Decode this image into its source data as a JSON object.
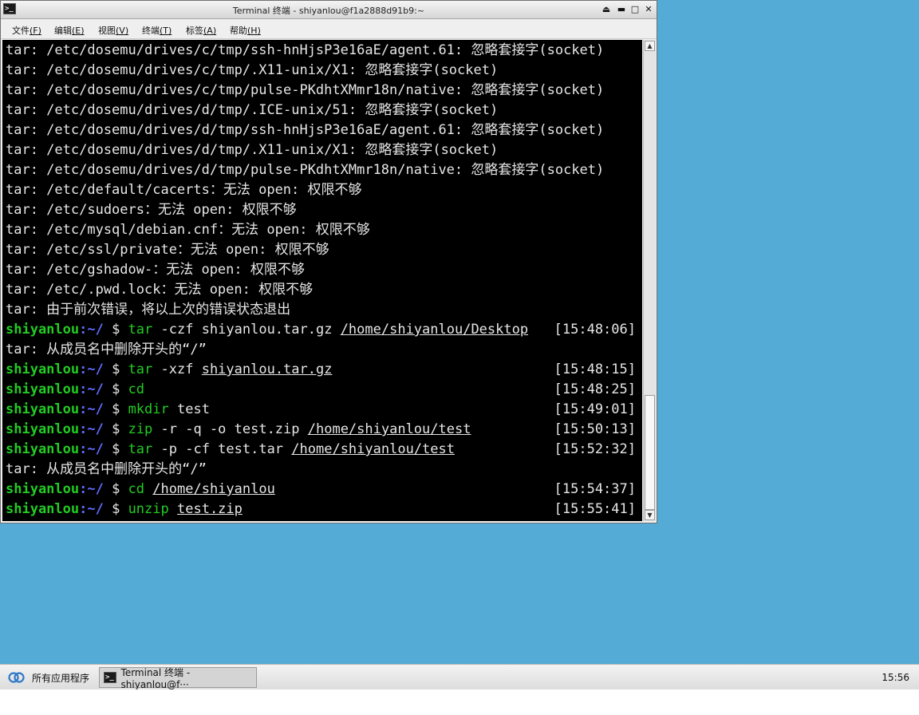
{
  "window": {
    "title": "Terminal 终端 - shiyanlou@f1a2888d91b9:~",
    "menu": [
      {
        "label": "文件",
        "key": "(F)"
      },
      {
        "label": "编辑",
        "key": "(E)"
      },
      {
        "label": "视图",
        "key": "(V)"
      },
      {
        "label": "终端",
        "key": "(T)"
      },
      {
        "label": "标签",
        "key": "(A)"
      },
      {
        "label": "帮助",
        "key": "(H)"
      }
    ]
  },
  "terminal": {
    "prompt_user": "shiyanlou",
    "prompt_path": ":~/",
    "prompt_sym": " $ ",
    "lines": [
      {
        "kind": "out",
        "text": "tar: /etc/dosemu/drives/c/tmp/ssh-hnHjsP3e16aE/agent.61: 忽略套接字(socket)"
      },
      {
        "kind": "out",
        "text": "tar: /etc/dosemu/drives/c/tmp/.X11-unix/X1: 忽略套接字(socket)"
      },
      {
        "kind": "out",
        "text": "tar: /etc/dosemu/drives/c/tmp/pulse-PKdhtXMmr18n/native: 忽略套接字(socket)"
      },
      {
        "kind": "out",
        "text": "tar: /etc/dosemu/drives/d/tmp/.ICE-unix/51: 忽略套接字(socket)"
      },
      {
        "kind": "out",
        "text": "tar: /etc/dosemu/drives/d/tmp/ssh-hnHjsP3e16aE/agent.61: 忽略套接字(socket)"
      },
      {
        "kind": "out",
        "text": "tar: /etc/dosemu/drives/d/tmp/.X11-unix/X1: 忽略套接字(socket)"
      },
      {
        "kind": "out",
        "text": "tar: /etc/dosemu/drives/d/tmp/pulse-PKdhtXMmr18n/native: 忽略套接字(socket)"
      },
      {
        "kind": "out",
        "text": "tar: /etc/default/cacerts：无法 open: 权限不够"
      },
      {
        "kind": "out",
        "text": "tar: /etc/sudoers：无法 open: 权限不够"
      },
      {
        "kind": "out",
        "text": "tar: /etc/mysql/debian.cnf：无法 open: 权限不够"
      },
      {
        "kind": "out",
        "text": "tar: /etc/ssl/private：无法 open: 权限不够"
      },
      {
        "kind": "out",
        "text": "tar: /etc/gshadow-：无法 open: 权限不够"
      },
      {
        "kind": "out",
        "text": "tar: /etc/.pwd.lock：无法 open: 权限不够"
      },
      {
        "kind": "out",
        "text": "tar: 由于前次错误，将以上次的错误状态退出"
      },
      {
        "kind": "cmd",
        "cmd": "tar",
        "pre": " -czf shiyanlou.tar.gz ",
        "arg": "/home/shiyanlou/Desktop",
        "post": "",
        "time": "[15:48:06]"
      },
      {
        "kind": "out",
        "text": "tar: 从成员名中删除开头的“/”"
      },
      {
        "kind": "cmd",
        "cmd": "tar",
        "pre": " -xzf ",
        "arg": "shiyanlou.tar.gz",
        "post": "",
        "time": "[15:48:15]"
      },
      {
        "kind": "cmd",
        "cmd": "cd",
        "pre": "",
        "arg": "",
        "post": "",
        "time": "[15:48:25]"
      },
      {
        "kind": "cmd",
        "cmd": "mkdir",
        "pre": " test",
        "arg": "",
        "post": "",
        "time": "[15:49:01]"
      },
      {
        "kind": "cmd",
        "cmd": "zip",
        "pre": " -r -q -o test.zip ",
        "arg": "/home/shiyanlou/test",
        "post": "",
        "time": "[15:50:13]"
      },
      {
        "kind": "cmd",
        "cmd": "tar",
        "pre": " -p -cf test.tar ",
        "arg": "/home/shiyanlou/test",
        "post": "",
        "time": "[15:52:32]"
      },
      {
        "kind": "out",
        "text": "tar: 从成员名中删除开头的“/”"
      },
      {
        "kind": "cmd",
        "cmd": "cd",
        "pre": " ",
        "arg": "/home/shiyanlou",
        "post": "",
        "time": "[15:54:37]"
      },
      {
        "kind": "cmd",
        "cmd": "unzip",
        "pre": " ",
        "arg": "test.zip",
        "post": "",
        "time": "[15:55:41]"
      }
    ]
  },
  "taskbar": {
    "start_label": "所有应用程序",
    "task_label": "Terminal 终端 - shiyanlou@f···",
    "clock": "15:56"
  },
  "colors": {
    "desktop": "#54acd6",
    "prompt_user": "#22cc22",
    "prompt_path": "#5d6cff",
    "terminal_bg": "#000000"
  }
}
